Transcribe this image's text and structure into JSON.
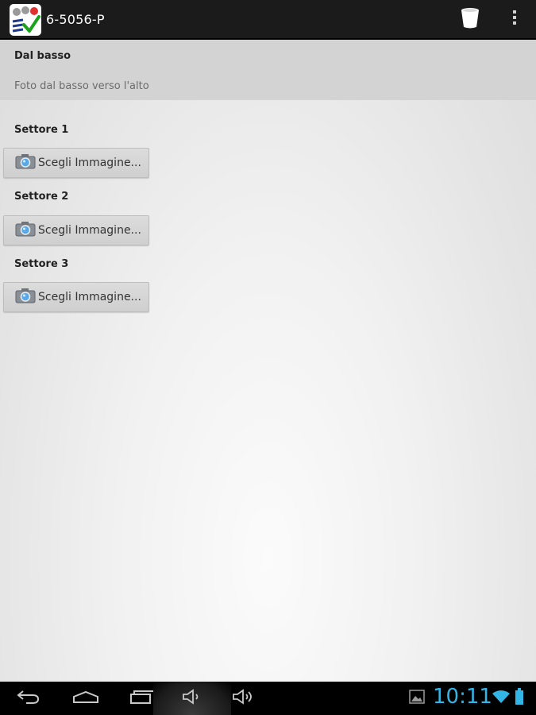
{
  "action_bar": {
    "title": "6-5056-P",
    "app_icon": "checklist-app-icon",
    "actions": [
      {
        "name": "trash-icon"
      },
      {
        "name": "overflow-menu-icon"
      }
    ]
  },
  "header": {
    "title": "Dal basso",
    "subtitle": "Foto dal basso verso l'alto"
  },
  "sectors": [
    {
      "label": "Settore 1",
      "button_label": "Scegli Immagine..."
    },
    {
      "label": "Settore 2",
      "button_label": "Scegli Immagine..."
    },
    {
      "label": "Settore 3",
      "button_label": "Scegli Immagine..."
    }
  ],
  "nav_bar": {
    "buttons": [
      "back-icon",
      "home-icon",
      "recent-apps-icon",
      "volume-down-icon",
      "volume-up-icon"
    ]
  },
  "status": {
    "time": "10:11",
    "icons": [
      "gallery-notification-icon",
      "wifi-icon",
      "battery-icon"
    ],
    "accent_color": "#33b5e5"
  }
}
